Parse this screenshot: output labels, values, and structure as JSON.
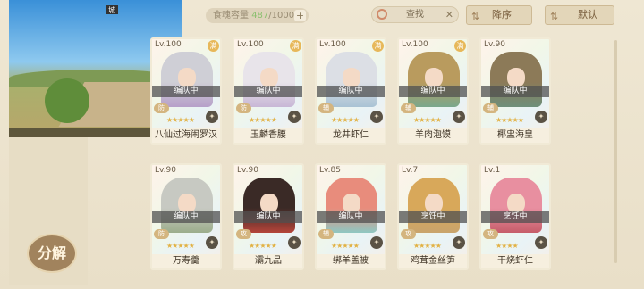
{
  "header": {
    "capacity_label": "食魂容量",
    "capacity_count": "487",
    "capacity_max": "/1000",
    "add": "+",
    "search_placeholder": "查找",
    "clear": "✕",
    "sort_label": "降序",
    "sort_mode_label": "默认"
  },
  "overlay": {
    "badge": "城"
  },
  "actions": {
    "decompose_label": "分解"
  },
  "cards": [
    {
      "level": "Lv.100",
      "status": "编队中",
      "name": "八仙过海闹罗汉",
      "badge": "防",
      "fav": "满",
      "elem": "✦",
      "stars": "★★★★★",
      "hair": "#cfcfd6",
      "accent": "#b7a0c9"
    },
    {
      "level": "Lv.100",
      "status": "编队中",
      "name": "玉麟香腰",
      "badge": "防",
      "fav": "满",
      "elem": "✦",
      "stars": "★★★★★",
      "hair": "#e8e4ea",
      "accent": "#c8b7d6"
    },
    {
      "level": "Lv.100",
      "status": "编队中",
      "name": "龙井虾仁",
      "badge": "辅",
      "fav": "满",
      "elem": "✦",
      "stars": "★★★★★",
      "hair": "#dcdfe5",
      "accent": "#a9c3d4"
    },
    {
      "level": "Lv.100",
      "status": "编队中",
      "name": "羊肉泡馍",
      "badge": "辅",
      "fav": "满",
      "elem": "✦",
      "stars": "★★★★★",
      "hair": "#b99b5e",
      "accent": "#7aa78c"
    },
    {
      "level": "Lv.90",
      "status": "编队中",
      "name": "椰盅海皇",
      "badge": "辅",
      "fav": "",
      "elem": "✦",
      "stars": "★★★★★",
      "hair": "#8c7a58",
      "accent": "#6f8f7a"
    },
    {
      "level": "Lv.90",
      "status": "编队中",
      "name": "万寿羹",
      "badge": "防",
      "fav": "",
      "elem": "✦",
      "stars": "★★★★★",
      "hair": "#c7c9c2",
      "accent": "#9cae8c"
    },
    {
      "level": "Lv.90",
      "status": "编队中",
      "name": "灞九品",
      "badge": "攻",
      "fav": "",
      "elem": "✦",
      "stars": "★★★★★",
      "hair": "#3a2a26",
      "accent": "#b4443a"
    },
    {
      "level": "Lv.85",
      "status": "编队中",
      "name": "绑羊盖被",
      "badge": "辅",
      "fav": "",
      "elem": "✦",
      "stars": "★★★★★",
      "hair": "#e88c7c",
      "accent": "#8fc7c2"
    },
    {
      "level": "Lv.7",
      "status": "烹饪中",
      "name": "鸡茸金丝笋",
      "badge": "攻",
      "fav": "",
      "elem": "✦",
      "stars": "★★★★★",
      "hair": "#d8a85a",
      "accent": "#c9a46c"
    },
    {
      "level": "Lv.1",
      "status": "烹饪中",
      "name": "干烧虾仁",
      "badge": "攻",
      "fav": "",
      "elem": "✦",
      "stars": "★★★★",
      "hair": "#e88fa0",
      "accent": "#c65d6a"
    }
  ]
}
